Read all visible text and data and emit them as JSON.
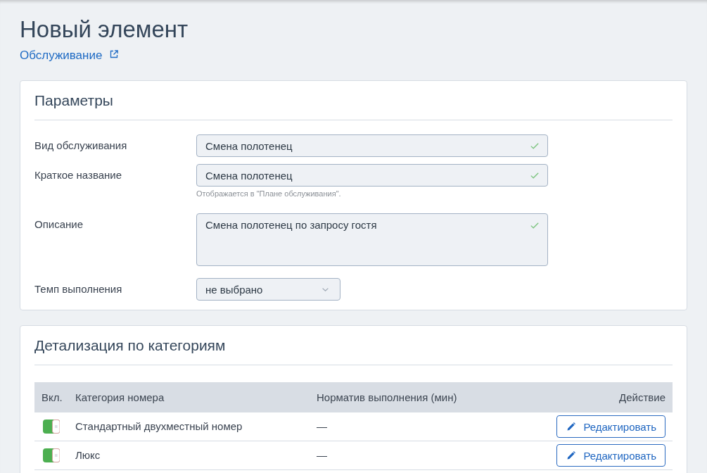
{
  "page": {
    "title": "Новый элемент",
    "link": "Обслуживание"
  },
  "parameters": {
    "title": "Параметры",
    "fields": [
      {
        "kind": "text",
        "label": "Вид обслуживания",
        "value": "Смена полотенец",
        "valid": true
      },
      {
        "kind": "text",
        "label": "Краткое название",
        "value": "Смена полотенец",
        "valid": true,
        "hint": "Отображается в \"Плане обслуживания\"."
      },
      {
        "kind": "textarea",
        "label": "Описание",
        "value": "Смена полотенец по запросу гостя",
        "valid": true
      },
      {
        "kind": "select",
        "label": "Темп выполнения",
        "value": "не выбрано"
      }
    ]
  },
  "details": {
    "title": "Детализация по категориям",
    "table": {
      "columns": [
        "Вкл.",
        "Категория номера",
        "Норматив выполнения (мин)",
        "Действие"
      ],
      "rows": [
        {
          "on": true,
          "category": "Стандартный двухместный номер",
          "norm": "—",
          "action": "Редактировать"
        },
        {
          "on": true,
          "category": "Люкс",
          "norm": "—",
          "action": "Редактировать"
        }
      ]
    }
  }
}
